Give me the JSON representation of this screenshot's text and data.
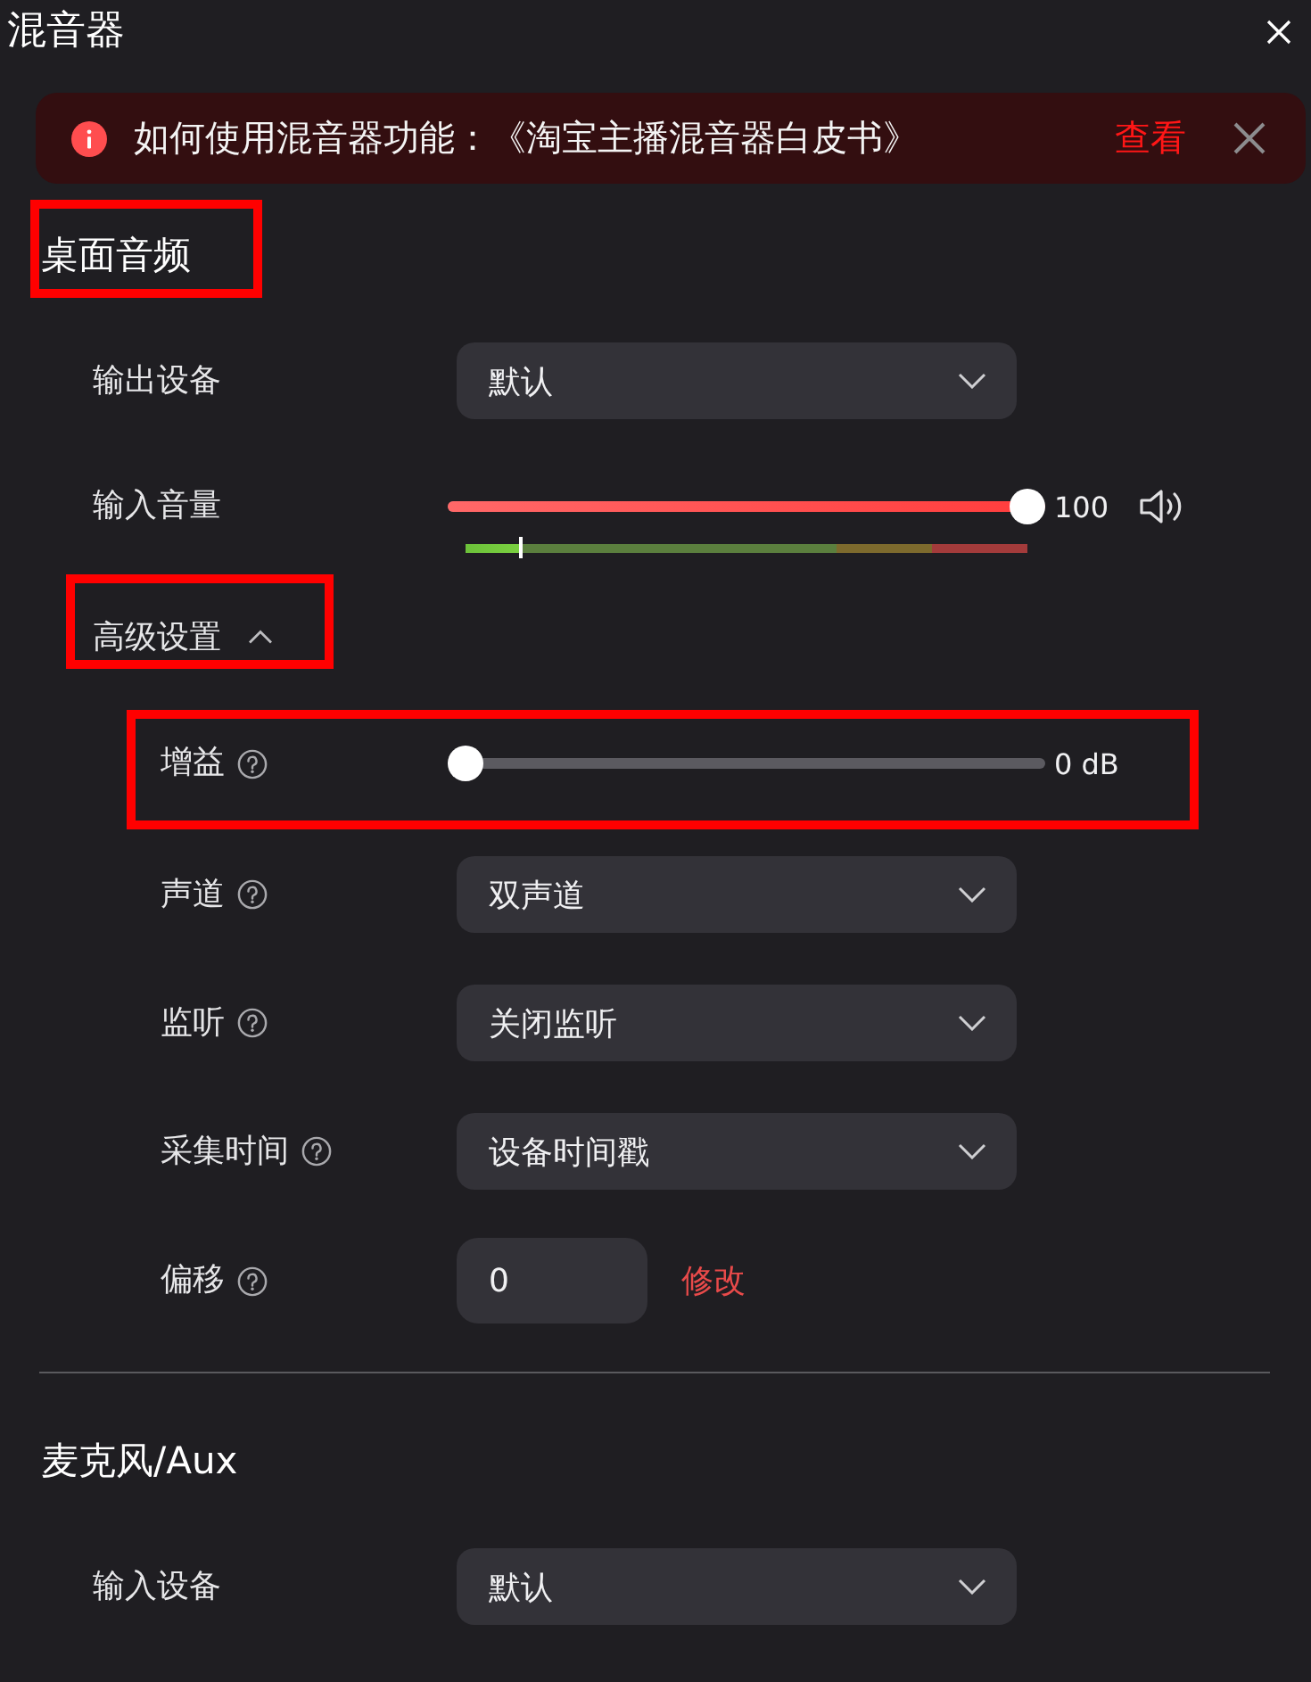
{
  "window": {
    "title": "混音器"
  },
  "banner": {
    "text": "如何使用混音器功能：《淘宝主播混音器白皮书》",
    "link": "查看"
  },
  "sections": [
    {
      "title": "桌面音频",
      "highlighted": true,
      "rows": [
        {
          "kind": "select",
          "label": "输出设备",
          "help": false,
          "highlighted": false,
          "value": "默认"
        },
        {
          "kind": "volume",
          "label": "输入音量",
          "help": false,
          "highlighted": false,
          "level": 1,
          "reading": "100",
          "meter": {
            "level": 0.095
          }
        }
      ],
      "advanced": {
        "label": "高级设置",
        "expanded": true,
        "highlighted": true,
        "rows": [
          {
            "kind": "slider",
            "label": "增益",
            "help": true,
            "highlighted": true,
            "level": 0,
            "reading": "0 dB"
          },
          {
            "kind": "select",
            "label": "声道",
            "help": true,
            "highlighted": false,
            "value": "双声道"
          },
          {
            "kind": "select",
            "label": "监听",
            "help": true,
            "highlighted": false,
            "value": "关闭监听"
          },
          {
            "kind": "select",
            "label": "采集时间",
            "help": true,
            "highlighted": false,
            "value": "设备时间戳"
          },
          {
            "kind": "number",
            "label": "偏移",
            "help": true,
            "highlighted": false,
            "value": "0",
            "action": "修改"
          }
        ]
      }
    },
    {
      "title": "麦克风/Aux",
      "highlighted": false,
      "rows": [
        {
          "kind": "select",
          "label": "输入设备",
          "help": false,
          "highlighted": false,
          "value": "默认"
        }
      ]
    }
  ]
}
